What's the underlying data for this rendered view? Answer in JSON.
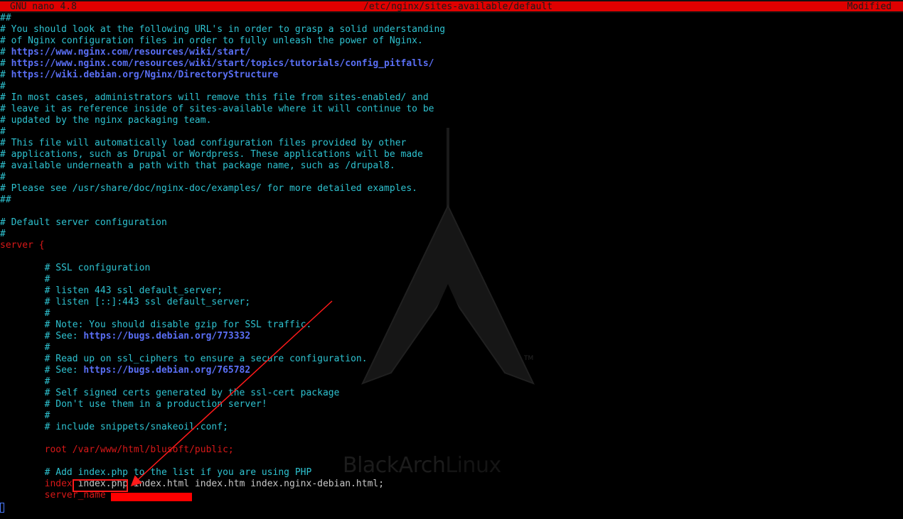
{
  "titlebar": {
    "app": "GNU nano 4.8",
    "file": "/etc/nginx/sites-available/default",
    "status": "Modified"
  },
  "watermark": {
    "brand_primary": "BlackArch",
    "brand_secondary": "Linux",
    "trademark": "TM"
  },
  "colors": {
    "titlebar_bg": "#e00000",
    "comment": "#2ec2d0",
    "url": "#5a6ff5",
    "keyword": "#d81818",
    "background": "#000000",
    "annotation": "#ff1a1a"
  },
  "lines": [
    [
      {
        "t": "##",
        "c": "comment"
      }
    ],
    [
      {
        "t": "# You should look at the following URL's in order to grasp a solid understanding",
        "c": "comment"
      }
    ],
    [
      {
        "t": "# of Nginx configuration files in order to fully unleash the power of Nginx.",
        "c": "comment"
      }
    ],
    [
      {
        "t": "# ",
        "c": "comment"
      },
      {
        "t": "https://www.nginx.com/resources/wiki/start/",
        "c": "url"
      }
    ],
    [
      {
        "t": "# ",
        "c": "comment"
      },
      {
        "t": "https://www.nginx.com/resources/wiki/start/topics/tutorials/config_pitfalls/",
        "c": "url"
      }
    ],
    [
      {
        "t": "# ",
        "c": "comment"
      },
      {
        "t": "https://wiki.debian.org/Nginx/DirectoryStructure",
        "c": "url"
      }
    ],
    [
      {
        "t": "#",
        "c": "comment"
      }
    ],
    [
      {
        "t": "# In most cases, administrators will remove this file from sites-enabled/ and",
        "c": "comment"
      }
    ],
    [
      {
        "t": "# leave it as reference inside of sites-available where it will continue to be",
        "c": "comment"
      }
    ],
    [
      {
        "t": "# updated by the nginx packaging team.",
        "c": "comment"
      }
    ],
    [
      {
        "t": "#",
        "c": "comment"
      }
    ],
    [
      {
        "t": "# This file will automatically load configuration files provided by other",
        "c": "comment"
      }
    ],
    [
      {
        "t": "# applications, such as Drupal or Wordpress. These applications will be made",
        "c": "comment"
      }
    ],
    [
      {
        "t": "# available underneath a path with that package name, such as /drupal8.",
        "c": "comment"
      }
    ],
    [
      {
        "t": "#",
        "c": "comment"
      }
    ],
    [
      {
        "t": "# Please see /usr/share/doc/nginx-doc/examples/ for more detailed examples.",
        "c": "comment"
      }
    ],
    [
      {
        "t": "##",
        "c": "comment"
      }
    ],
    [
      {
        "t": "",
        "c": "plain"
      }
    ],
    [
      {
        "t": "# Default server configuration",
        "c": "comment"
      }
    ],
    [
      {
        "t": "#",
        "c": "comment"
      }
    ],
    [
      {
        "t": "server {",
        "c": "red"
      }
    ],
    [
      {
        "t": "",
        "c": "plain"
      }
    ],
    [
      {
        "t": "        # SSL configuration",
        "c": "comment"
      }
    ],
    [
      {
        "t": "        #",
        "c": "comment"
      }
    ],
    [
      {
        "t": "        # listen 443 ssl default_server;",
        "c": "comment"
      }
    ],
    [
      {
        "t": "        # listen [::]:443 ssl default_server;",
        "c": "comment"
      }
    ],
    [
      {
        "t": "        #",
        "c": "comment"
      }
    ],
    [
      {
        "t": "        # Note: You should disable gzip for SSL traffic.",
        "c": "comment"
      }
    ],
    [
      {
        "t": "        # See: ",
        "c": "comment"
      },
      {
        "t": "https://bugs.debian.org/773332",
        "c": "url"
      }
    ],
    [
      {
        "t": "        #",
        "c": "comment"
      }
    ],
    [
      {
        "t": "        # Read up on ssl_ciphers to ensure a secure configuration.",
        "c": "comment"
      }
    ],
    [
      {
        "t": "        # See: ",
        "c": "comment"
      },
      {
        "t": "https://bugs.debian.org/765782",
        "c": "url"
      }
    ],
    [
      {
        "t": "        #",
        "c": "comment"
      }
    ],
    [
      {
        "t": "        # Self signed certs generated by the ssl-cert package",
        "c": "comment"
      }
    ],
    [
      {
        "t": "        # Don't use them in a production server!",
        "c": "comment"
      }
    ],
    [
      {
        "t": "        #",
        "c": "comment"
      }
    ],
    [
      {
        "t": "        # include snippets/snakeoil.conf;",
        "c": "comment"
      }
    ],
    [
      {
        "t": "",
        "c": "plain"
      }
    ],
    [
      {
        "t": "        root /var/www/html/blusoft/public;",
        "c": "red"
      }
    ],
    [
      {
        "t": "",
        "c": "plain"
      }
    ],
    [
      {
        "t": "        # Add index.php to the list if you are using PHP",
        "c": "comment"
      }
    ],
    [
      {
        "t": "        index ",
        "c": "red"
      },
      {
        "t": "index.php ",
        "c": "plain"
      },
      {
        "t": "index.html index.htm index.nginx-debian.html;",
        "c": "plain"
      }
    ],
    [
      {
        "t": "        server_name ",
        "c": "red"
      }
    ],
    [
      {
        "t": "",
        "c": "plain"
      }
    ]
  ]
}
